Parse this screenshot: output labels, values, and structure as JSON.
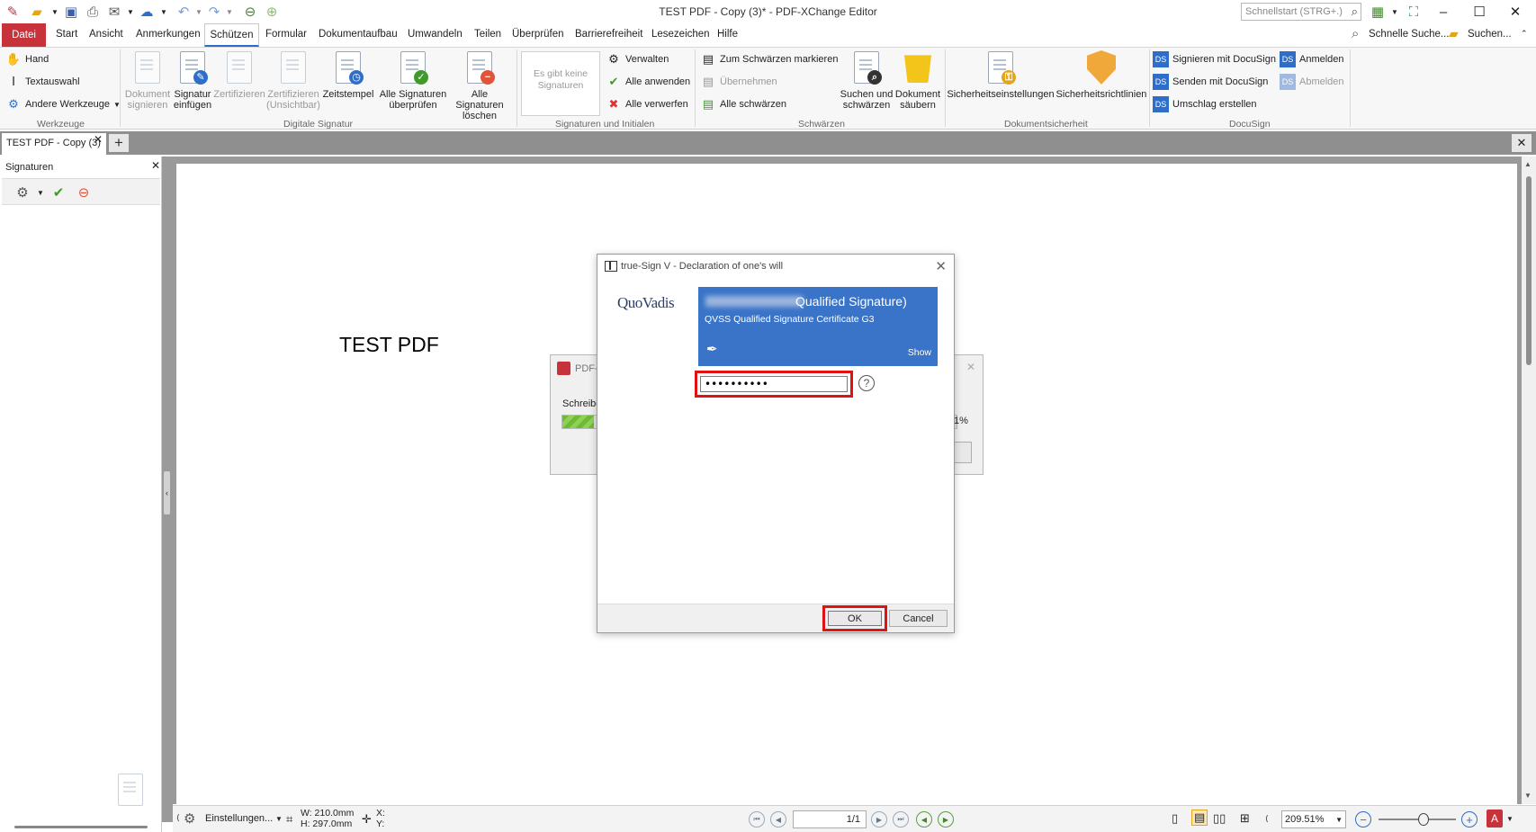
{
  "window": {
    "title": "TEST PDF - Copy (3)* - PDF-XChange Editor",
    "quickstart_placeholder": "Schnellstart (STRG+.)"
  },
  "menu": {
    "file": "Datei",
    "items": [
      "Start",
      "Ansicht",
      "Anmerkungen",
      "Schützen",
      "Formular",
      "Dokumentaufbau",
      "Umwandeln",
      "Teilen",
      "Überprüfen",
      "Barrierefreiheit",
      "Lesezeichen",
      "Hilfe"
    ],
    "active": "Schützen",
    "quick_search": "Schnelle Suche...",
    "search": "Suchen..."
  },
  "ribbon": {
    "werkzeuge": {
      "label": "Werkzeuge",
      "hand": "Hand",
      "textauswahl": "Textauswahl",
      "andere": "Andere Werkzeuge"
    },
    "digitale_signatur": {
      "label": "Digitale Signatur",
      "buttons": [
        {
          "line1": "Dokument",
          "line2": "signieren",
          "disabled": true
        },
        {
          "line1": "Signatur",
          "line2": "einfügen",
          "disabled": false
        },
        {
          "line1": "Zertifizieren",
          "line2": "",
          "disabled": true
        },
        {
          "line1": "Zertifizieren",
          "line2": "(Unsichtbar)",
          "disabled": true
        },
        {
          "line1": "Zeitstempel",
          "line2": "",
          "disabled": false
        },
        {
          "line1": "Alle Signaturen",
          "line2": "überprüfen",
          "disabled": false
        },
        {
          "line1": "Alle Signaturen",
          "line2": "löschen",
          "disabled": false
        }
      ]
    },
    "signaturen_initialen": {
      "label": "Signaturen und Initialen",
      "empty_line1": "Es gibt keine",
      "empty_line2": "Signaturen",
      "verwalten": "Verwalten",
      "alle_anwenden": "Alle anwenden",
      "alle_verwerfen": "Alle verwerfen"
    },
    "schwaerzen": {
      "label": "Schwärzen",
      "markieren": "Zum Schwärzen markieren",
      "uebernehmen": "Übernehmen",
      "alle": "Alle schwärzen",
      "suchen_line1": "Suchen und",
      "suchen_line2": "schwärzen",
      "saeubern_line1": "Dokument",
      "saeubern_line2": "säubern"
    },
    "dokumentsicherheit": {
      "label": "Dokumentsicherheit",
      "einstellungen": "Sicherheitseinstellungen",
      "richtlinien": "Sicherheitsrichtlinien"
    },
    "docusign": {
      "label": "DocuSign",
      "signieren": "Signieren mit DocuSign",
      "senden": "Senden mit DocuSign",
      "umschlag": "Umschlag erstellen",
      "anmelden": "Anmelden",
      "abmelden": "Abmelden"
    }
  },
  "tabs": {
    "doc_tab": "TEST PDF - Copy (3)"
  },
  "sidebar": {
    "title": "Signaturen"
  },
  "document": {
    "text": "TEST PDF"
  },
  "progress_dialog": {
    "title": "PDF-",
    "label": "Schreibe",
    "percent": "1%",
    "fill_fraction": 0.08
  },
  "dialog": {
    "title": "true-Sign V - Declaration of one's will",
    "logo": "QuoVadis",
    "cert_name": "Qualified Signature)",
    "cert_issuer": "QVSS Qualified Signature Certificate G3",
    "show": "Show",
    "pin_value": "••••••••••",
    "help": "?",
    "ok": "OK",
    "cancel": "Cancel"
  },
  "statusbar": {
    "settings": "Einstellungen...",
    "width": "W: 210.0mm",
    "height": "H: 297.0mm",
    "x": "X:",
    "y": "Y:",
    "page": "1/1",
    "zoom": "209.51%"
  },
  "colors": {
    "accent": "#2e6ec8",
    "file_menu": "#c8323a",
    "highlight": "#e01313",
    "cert_card": "#3a74c8"
  }
}
